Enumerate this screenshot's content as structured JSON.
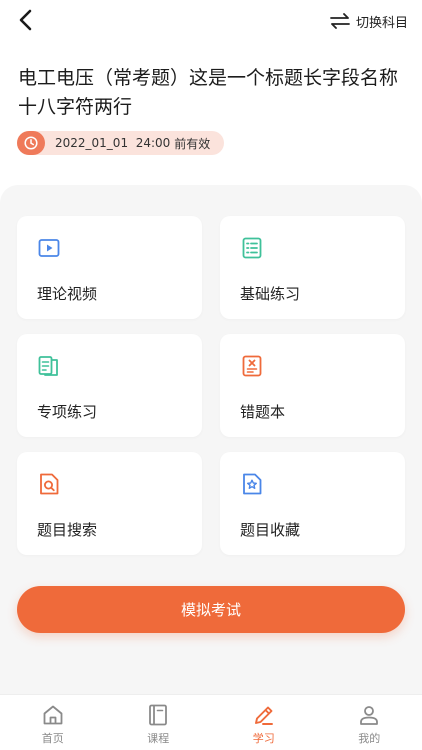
{
  "header": {
    "switch_label": "切换科目"
  },
  "title": "电工电压（常考题）这是一个标题长字段名称十八字符两行",
  "validity": {
    "date": "2022_01_01  24:00",
    "suffix": "前有效"
  },
  "cards": [
    {
      "label": "理论视频",
      "icon": "video-play-icon",
      "color": "#4a86e8"
    },
    {
      "label": "基础练习",
      "icon": "list-doc-icon",
      "color": "#3fc19a"
    },
    {
      "label": "专项练习",
      "icon": "book-doc-icon",
      "color": "#3fc19a"
    },
    {
      "label": "错题本",
      "icon": "wrong-doc-icon",
      "color": "#ef6a3a"
    },
    {
      "label": "题目搜索",
      "icon": "search-doc-icon",
      "color": "#ef6a3a"
    },
    {
      "label": "题目收藏",
      "icon": "star-doc-icon",
      "color": "#4a86e8"
    }
  ],
  "exam_button": "模拟考试",
  "tabs": [
    {
      "label": "首页",
      "icon": "home-icon",
      "active": false
    },
    {
      "label": "课程",
      "icon": "course-book-icon",
      "active": false
    },
    {
      "label": "学习",
      "icon": "pencil-icon",
      "active": true
    },
    {
      "label": "我的",
      "icon": "user-icon",
      "active": false
    }
  ],
  "colors": {
    "accent": "#ef6a3a",
    "panel_bg": "#f6f6f6",
    "badge_bg": "#fbe3dc"
  }
}
